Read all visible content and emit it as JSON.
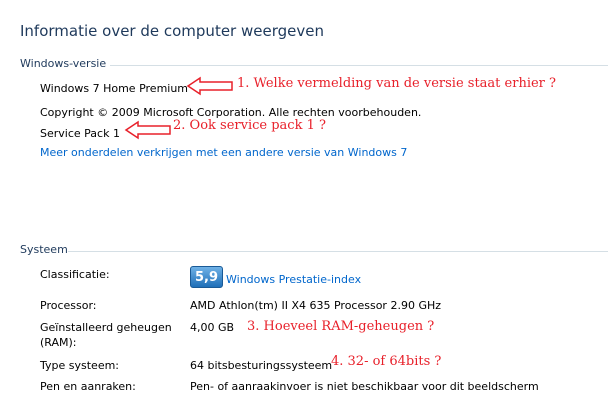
{
  "page": {
    "title": "Informatie over de computer weergeven"
  },
  "windows_edition": {
    "section_title": "Windows-versie",
    "edition": "Windows 7 Home Premium",
    "copyright": "Copyright © 2009 Microsoft Corporation. Alle rechten voorbehouden.",
    "service_pack": "Service Pack 1",
    "more_features_link": "Meer onderdelen verkrijgen met een andere versie van Windows 7"
  },
  "system": {
    "section_title": "Systeem",
    "rating_label": "Classificatie:",
    "rating_score": "5,9",
    "rating_link": "Windows Prestatie-index",
    "processor_label": "Processor:",
    "processor_value": "AMD Athlon(tm) II X4 635 Processor   2.90 GHz",
    "ram_label_line1": "Geïnstalleerd geheugen",
    "ram_label_line2": "(RAM):",
    "ram_value": "4,00 GB",
    "type_label": "Type systeem:",
    "type_value": "64 bitsbesturingssysteem",
    "pen_label": "Pen en aanraken:",
    "pen_value": "Pen- of aanraakinvoer is niet beschikbaar voor dit beeldscherm"
  },
  "annotations": {
    "a1": "1. Welke vermelding van de versie staat erhier ?",
    "a2": "2. Ook service pack 1  ?",
    "a3": "3. Hoeveel RAM-geheugen ?",
    "a4": "4. 32- of 64bits ?"
  },
  "colors": {
    "heading": "#1e395b",
    "link": "#0066cc",
    "annotation": "#e8202a",
    "wei_badge": "#1f6fb8"
  }
}
